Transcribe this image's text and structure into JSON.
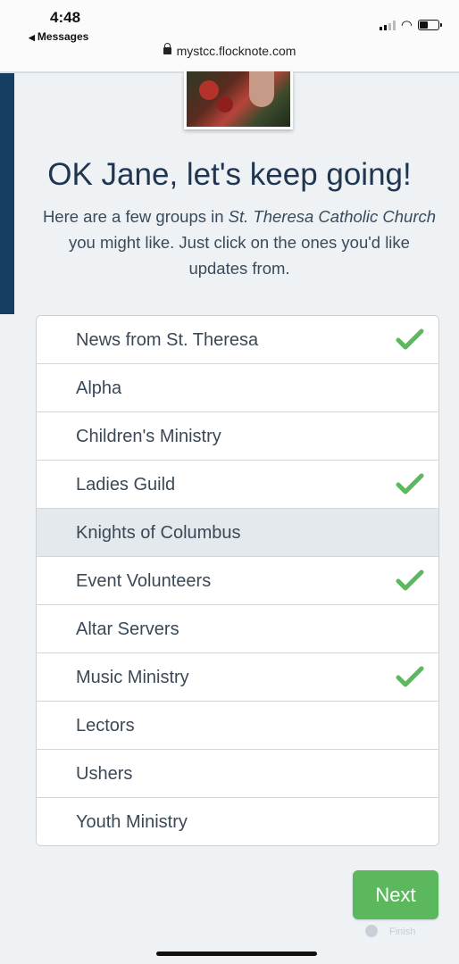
{
  "status_bar": {
    "time": "4:48",
    "back_app": "Messages",
    "url": "mystcc.flocknote.com"
  },
  "header": {
    "title": "OK Jane, let's keep going!",
    "intro_prefix": "Here are a few groups in ",
    "church_name": "St. Theresa Catholic Church",
    "intro_suffix": " you might like. Just click on the ones you'd like updates from."
  },
  "groups": [
    {
      "label": "News from St. Theresa",
      "selected": true
    },
    {
      "label": "Alpha",
      "selected": false
    },
    {
      "label": "Children's Ministry",
      "selected": false
    },
    {
      "label": "Ladies Guild",
      "selected": true
    },
    {
      "label": "Knights of Columbus",
      "selected": false,
      "highlighted": true
    },
    {
      "label": "Event Volunteers",
      "selected": true
    },
    {
      "label": "Altar Servers",
      "selected": false
    },
    {
      "label": "Music Ministry",
      "selected": true
    },
    {
      "label": "Lectors",
      "selected": false
    },
    {
      "label": "Ushers",
      "selected": false
    },
    {
      "label": "Youth Ministry",
      "selected": false
    }
  ],
  "actions": {
    "next_label": "Next",
    "faded_label": "Finish"
  },
  "colors": {
    "accent_green": "#5cb85c",
    "heading": "#1f3550",
    "left_band": "#163e63"
  },
  "icons": {
    "selected": "check-icon",
    "secure": "lock-icon"
  }
}
